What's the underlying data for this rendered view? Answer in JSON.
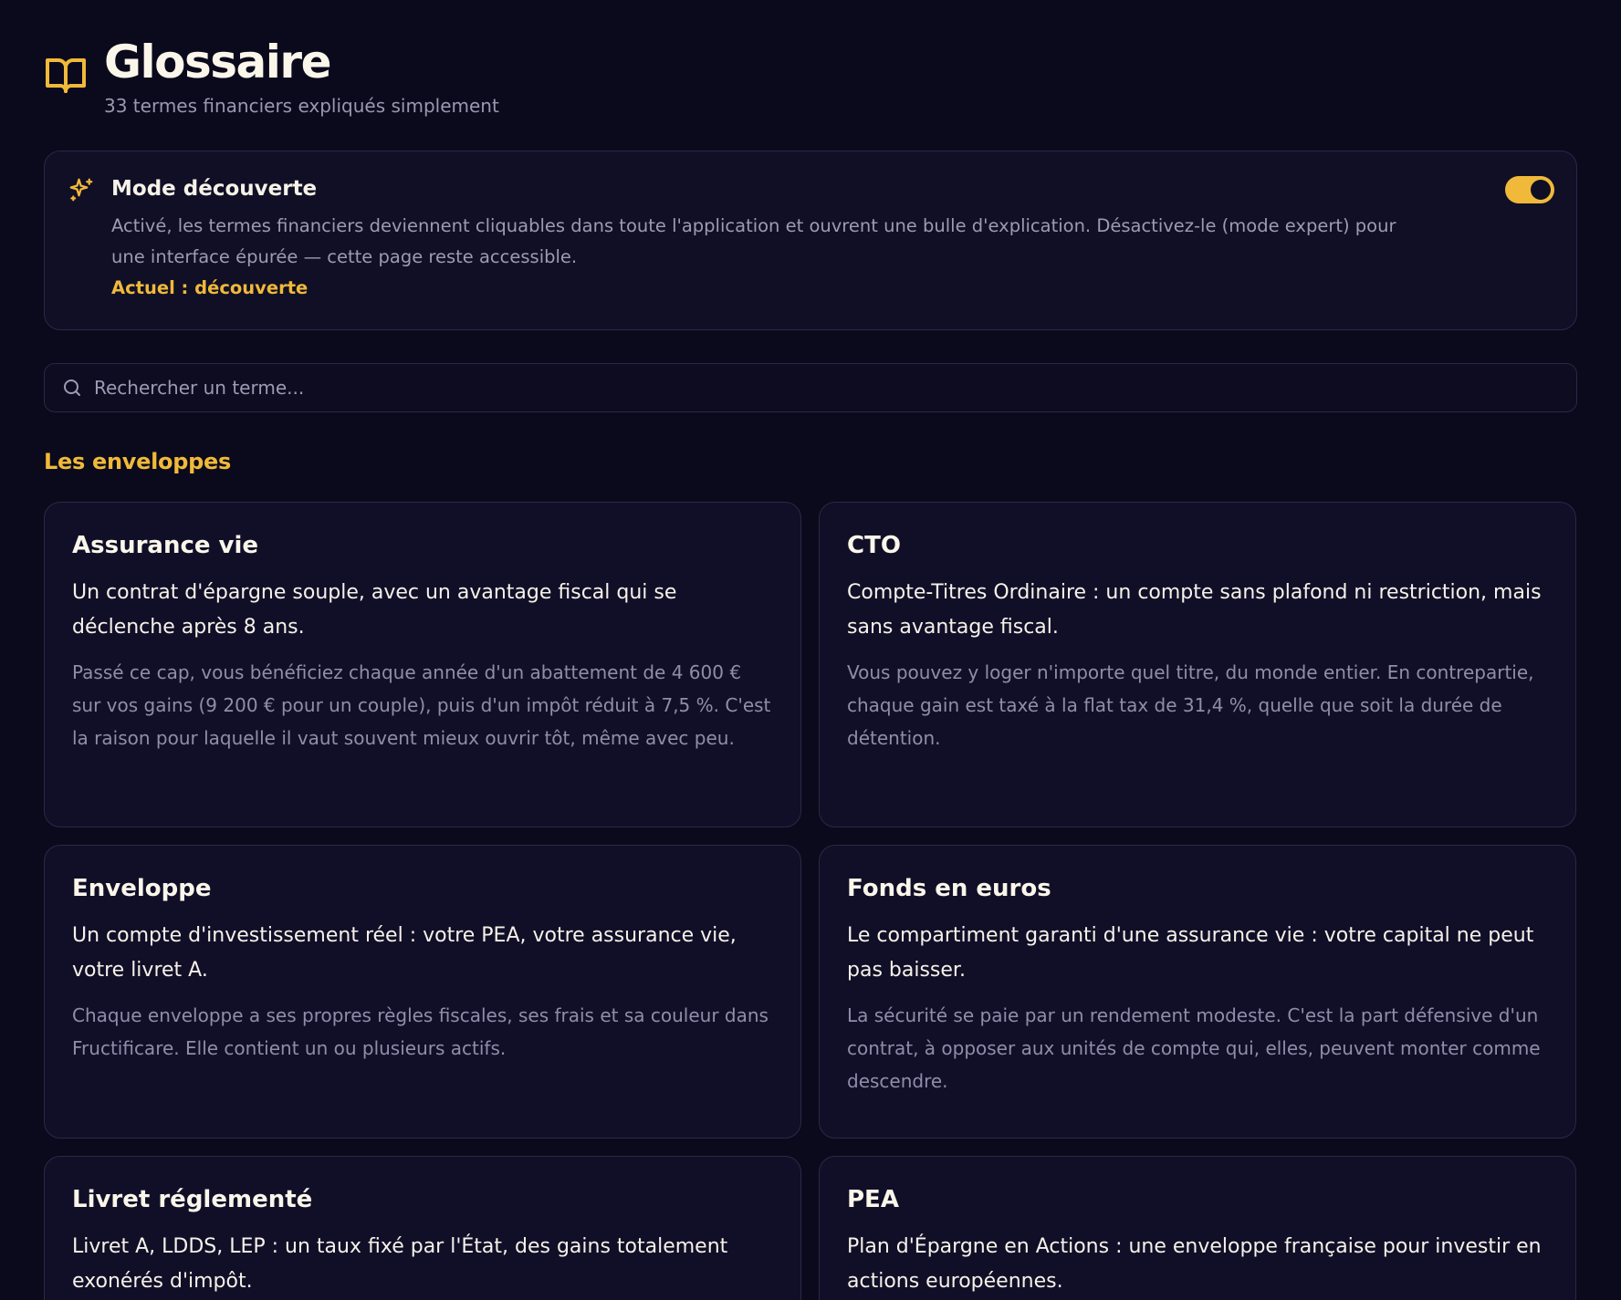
{
  "header": {
    "title": "Glossaire",
    "subtitle": "33 termes financiers expliqués simplement"
  },
  "discovery": {
    "title": "Mode découverte",
    "description": "Activé, les termes financiers deviennent cliquables dans toute l'application et ouvrent une bulle d'explication. Désactivez-le (mode expert) pour une interface épurée — cette page reste accessible.",
    "current": "Actuel : découverte",
    "toggle_on": true
  },
  "search": {
    "placeholder": "Rechercher un terme..."
  },
  "section": {
    "title": "Les enveloppes"
  },
  "cards": [
    {
      "title": "Assurance vie",
      "lead": "Un contrat d'épargne souple, avec un avantage fiscal qui se déclenche après 8 ans.",
      "body": "Passé ce cap, vous bénéficiez chaque année d'un abattement de 4 600 € sur vos gains (9 200 € pour un couple), puis d'un impôt réduit à 7,5 %. C'est la raison pour laquelle il vaut souvent mieux ouvrir tôt, même avec peu."
    },
    {
      "title": "CTO",
      "lead": "Compte-Titres Ordinaire : un compte sans plafond ni restriction, mais sans avantage fiscal.",
      "body": "Vous pouvez y loger n'importe quel titre, du monde entier. En contrepartie, chaque gain est taxé à la flat tax de 31,4 %, quelle que soit la durée de détention."
    },
    {
      "title": "Enveloppe",
      "lead": "Un compte d'investissement réel : votre PEA, votre assurance vie, votre livret A.",
      "body": "Chaque enveloppe a ses propres règles fiscales, ses frais et sa couleur dans Fructificare. Elle contient un ou plusieurs actifs."
    },
    {
      "title": "Fonds en euros",
      "lead": "Le compartiment garanti d'une assurance vie : votre capital ne peut pas baisser.",
      "body": "La sécurité se paie par un rendement modeste. C'est la part défensive d'un contrat, à opposer aux unités de compte qui, elles, peuvent monter comme descendre."
    },
    {
      "title": "Livret réglementé",
      "lead": "Livret A, LDDS, LEP : un taux fixé par l'État, des gains totalement exonérés d'impôt.",
      "body": ""
    },
    {
      "title": "PEA",
      "lead": "Plan d'Épargne en Actions : une enveloppe française pour investir en actions européennes.",
      "body": ""
    }
  ],
  "colors": {
    "background": "#0b0a1c",
    "accent": "#f0b93a",
    "card": "#110f28"
  }
}
